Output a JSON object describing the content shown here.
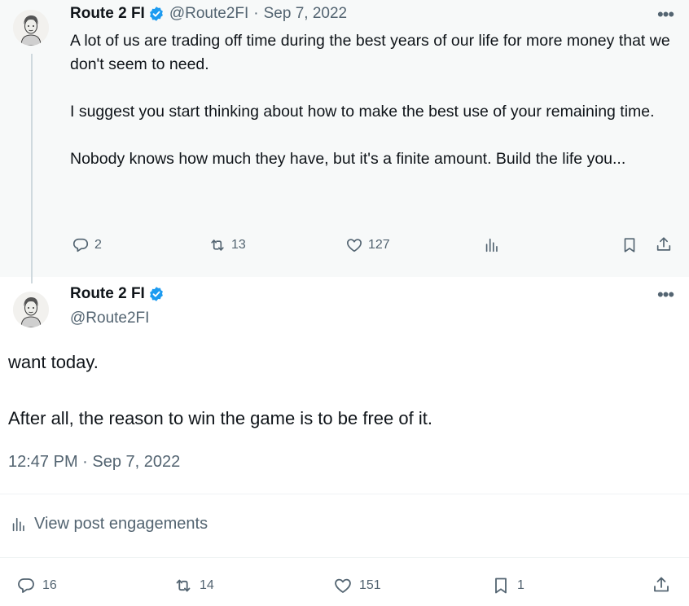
{
  "parent_tweet": {
    "author": {
      "name": "Route 2 FI",
      "handle": "@Route2FI"
    },
    "date": "Sep 7, 2022",
    "separator": "·",
    "more_label": "•••",
    "text_paragraphs": [
      "A lot of us are trading off time during the best years of our life for more money that we don't seem to need.",
      "I suggest you start thinking about how to make the best use of your remaining time.",
      "Nobody knows how much they have, but it's a finite amount. Build the life you..."
    ],
    "actions": {
      "replies": "2",
      "retweets": "13",
      "likes": "127",
      "views": ""
    },
    "icons": [
      "reply-icon",
      "retweet-icon",
      "like-icon",
      "views-icon",
      "bookmark-icon",
      "share-icon",
      "verified-badge-icon",
      "more-icon"
    ]
  },
  "main_tweet": {
    "author": {
      "name": "Route 2 FI",
      "handle": "@Route2FI"
    },
    "more_label": "•••",
    "text_paragraphs": [
      "want today.",
      "After all, the reason to win the game is to be free of it."
    ],
    "timestamp": "12:47 PM · Sep 7, 2022",
    "engagements_label": "View post engagements",
    "actions": {
      "replies": "16",
      "retweets": "14",
      "likes": "151",
      "bookmarks": "1"
    }
  },
  "colors": {
    "text": "#0f1419",
    "secondary": "#536471",
    "verified": "#1d9bf0",
    "thread_line": "#cfd9de",
    "parent_bg": "#f7f9f9"
  }
}
